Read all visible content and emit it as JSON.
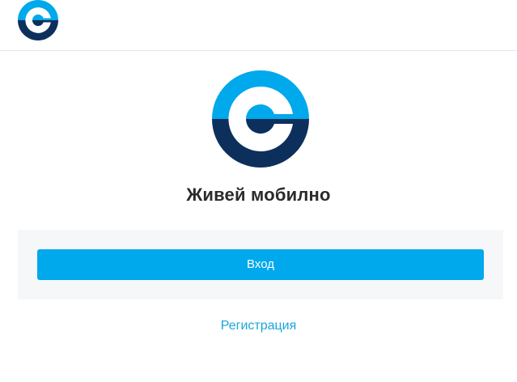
{
  "header": {
    "logo_icon": "brand-logo-icon"
  },
  "brand": {
    "colors": {
      "light_blue": "#00a8ec",
      "dark_blue": "#0d2f5c",
      "white": "#ffffff"
    },
    "hero_icon": "brand-logo-icon"
  },
  "main": {
    "tagline": "Живей мобилно",
    "login_label": "Вход",
    "register_label": "Регистрация"
  }
}
